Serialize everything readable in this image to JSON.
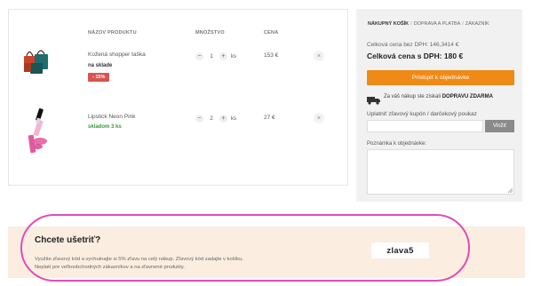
{
  "cart": {
    "columns": [
      "NÁZOV PRODUKTU",
      "MNOŽSTVO",
      "CENA"
    ],
    "items": [
      {
        "name": "Kožená shopper taška",
        "stock": "na sklade",
        "badge": "- 15%",
        "qty": "1",
        "unit": "ks",
        "price": "153 €",
        "minus": "−",
        "plus": "+",
        "remove": "×",
        "image_icon": "shopper-bag-icon"
      },
      {
        "name": "Lipstick Neon Pink",
        "stock": "skladom 3 ks",
        "qty": "2",
        "unit": "ks",
        "price": "27 €",
        "minus": "−",
        "plus": "+",
        "remove": "×",
        "image_icon": "lipstick-icon"
      }
    ]
  },
  "sidebar": {
    "breadcrumb": [
      "NÁKUPNÝ KOŠÍK",
      "DOPRAVA A PLATBA",
      "ZÁKAZNÍK"
    ],
    "breadcrumb_sep": "/",
    "total_no_vat": "Celková cena bez DPH: 146,3414 €",
    "total_with_vat": "Celková cena s DPH: 180 €",
    "order_button": "Pristúpiť k objednávke",
    "shipping_prefix": "Za váš nákup ste získali",
    "shipping_bold": "DOPRAVU ZDARMA",
    "coupon_label": "Uplatniť zľavový kupón / darčekový poukaz",
    "coupon_value": "",
    "apply_button": "Vložiť",
    "note_label": "Poznámka k objednávke:",
    "note_value": ""
  },
  "promo": {
    "title": "Chcete ušetriť?",
    "line1": "Využite zľavový kód a vychutnajte si 5% zľavu na celý nákup. Zľavový kód zadajte v košíku.",
    "line2": "Neplatí pre veľkoobchodných zákazníkov a na zľavnené produkty.",
    "code": "zlava5"
  },
  "colors": {
    "accent": "#ef8a17",
    "badge": "#d9534f",
    "in_stock": "#3a9a3a",
    "promo_bg": "#fbeee0",
    "highlight": "#e24bb7"
  }
}
